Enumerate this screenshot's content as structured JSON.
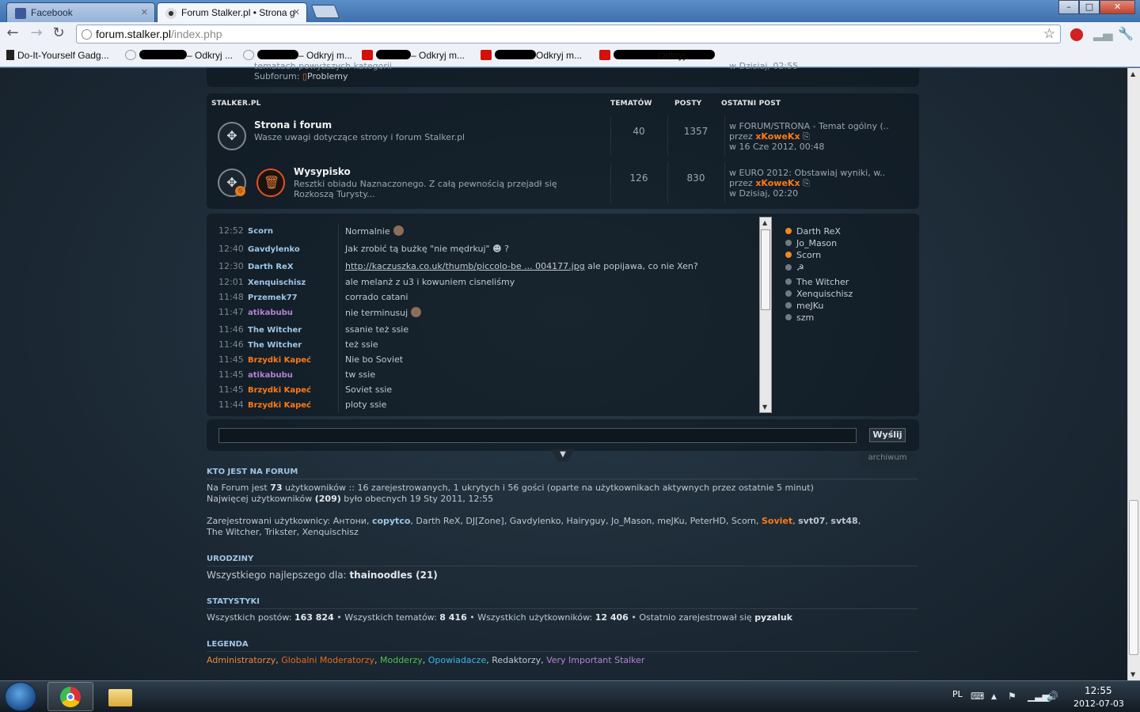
{
  "browser": {
    "tabs": [
      {
        "label": "Facebook",
        "icon": "facebook-icon"
      },
      {
        "label": "Forum Stalker.pl • Strona g",
        "icon": "stalker-icon"
      }
    ],
    "window_controls": {
      "minimize": "–",
      "maximize": "□",
      "close": "✕"
    },
    "address": {
      "host": "forum.stalker.pl",
      "path": "/index.php"
    },
    "bookmarks": [
      {
        "label": "Do-It-Yourself Gadg...",
        "icon": "bookmark-icon"
      },
      {
        "label": "– Odkryj ...",
        "icon": "globe-icon"
      },
      {
        "label": "– Odkryj m...",
        "icon": "globe-icon"
      },
      {
        "label": "– Odkryj m...",
        "icon": "lastfm-icon"
      },
      {
        "label": "Odkryj m...",
        "icon": "lastfm-icon"
      },
      {
        "label": "Odkryj",
        "icon": "lastfm-icon"
      }
    ]
  },
  "top_fragment": {
    "partial_text": "tematach powyższych kategorii",
    "subforum_label": "Subforum:",
    "subforum_link": "Problemy",
    "right_partial": "w Dzisiaj, 02:55"
  },
  "category": {
    "name": "STALKER.PL",
    "col_topics": "TEMATÓW",
    "col_posts": "POSTY",
    "col_last": "OSTATNI POST",
    "forums": [
      {
        "title": "Strona i forum",
        "desc1": "Wasze uwagi dotyczące strony i forum Stalker.pl",
        "desc2": "",
        "topics": "40",
        "posts": "1357",
        "last_in": "w FORUM/STRONA - Temat ogólny (..",
        "last_by_prefix": "przez",
        "last_user": "xKoweKx",
        "last_date": "w 16 Cze 2012, 00:48"
      },
      {
        "title": "Wysypisko",
        "desc1": "Resztki obiadu Naznaczonego. Z całą pewnością przejadł się",
        "desc2": "Rozkoszą Turysty...",
        "topics": "126",
        "posts": "830",
        "last_in": "w EURO 2012: Obstawiaj wyniki, w..",
        "last_by_prefix": "przez",
        "last_user": "xKoweKx",
        "last_date": "w Dzisiaj, 02:20"
      }
    ]
  },
  "chat": {
    "messages": [
      {
        "time": "12:52",
        "user": "Scorn",
        "color": "u-blue",
        "text": "Normalnie",
        "emoji": true
      },
      {
        "time": "12:40",
        "user": "Gavdylenko",
        "color": "u-blue",
        "text": "Jak zrobić tą bużkę \"nie mędrkuj\"",
        "suffix": "?",
        "emoji2": true
      },
      {
        "time": "12:30",
        "user": "Darth ReX",
        "color": "u-blue",
        "link": "http://kaczuszka.co.uk/thumb/piccolo-be ... 004177.jpg",
        "text": " ale popijawa, co nie Xen?"
      },
      {
        "time": "12:01",
        "user": "Xenquischisz",
        "color": "u-blue",
        "text": "ale melanż z u3 i kowuniem cisneliśmy"
      },
      {
        "time": "11:48",
        "user": "Przemek77",
        "color": "u-blue",
        "text": "corrado catani"
      },
      {
        "time": "11:47",
        "user": "atikabubu",
        "color": "u-purple",
        "text": "nie terminusuj",
        "emoji": true
      },
      {
        "time": "11:46",
        "user": "The Witcher",
        "color": "u-blue",
        "text": "ssanie też ssie"
      },
      {
        "time": "11:46",
        "user": "The Witcher",
        "color": "u-blue",
        "text": "też ssie"
      },
      {
        "time": "11:45",
        "user": "Brzydki Kapeć",
        "color": "u-orange",
        "text": "Nie bo Soviet"
      },
      {
        "time": "11:45",
        "user": "atikabubu",
        "color": "u-purple",
        "text": "tw ssie"
      },
      {
        "time": "11:45",
        "user": "Brzydki Kapeć",
        "color": "u-orange",
        "text": "Soviet ssie"
      },
      {
        "time": "11:44",
        "user": "Brzydki Kapeć",
        "color": "u-orange",
        "text": "ploty ssie"
      }
    ],
    "online": [
      {
        "name": "Darth ReX",
        "dot": "orange"
      },
      {
        "name": "Jo_Mason",
        "dot": "gray"
      },
      {
        "name": "Scorn",
        "dot": "orange"
      },
      {
        "name": "☭",
        "dot": "gray"
      },
      {
        "name": "The Witcher",
        "dot": "gray"
      },
      {
        "name": "Xenquischisz",
        "dot": "gray"
      },
      {
        "name": "meJKu",
        "dot": "gray"
      },
      {
        "name": "szm",
        "dot": "gray"
      }
    ],
    "input_value": "",
    "send_label": "Wyślij",
    "archive_label": "archiwum"
  },
  "who_online": {
    "heading": "KTO JEST NA FORUM",
    "line1_pre": "Na Forum jest",
    "line1_total": "73",
    "line1_post": "użytkowników :: 16 zarejestrowanych, 1 ukrytych i 56 gości (oparte na użytkownikach aktywnych przez ostatnie 5 minut)",
    "line2_pre": "Najwięcej użytkowników",
    "line2_max": "(209)",
    "line2_post": "było obecnych 19 Sty 2011, 12:55",
    "registered_label": "Zarejestrowani użytkownicy:",
    "registered_line1": [
      {
        "name": "Антони",
        "cls": "reg-user",
        "sep": ", "
      },
      {
        "name": "copytco",
        "cls": "u-blue b",
        "sep": ", "
      },
      {
        "name": "Darth ReX",
        "cls": "reg-user",
        "sep": ", "
      },
      {
        "name": "DJ[Zone]",
        "cls": "reg-user",
        "sep": ", "
      },
      {
        "name": "Gavdylenko",
        "cls": "reg-user",
        "sep": ", "
      },
      {
        "name": "Hairyguy",
        "cls": "reg-user",
        "sep": ", "
      },
      {
        "name": "Jo_Mason",
        "cls": "reg-user",
        "sep": ", "
      },
      {
        "name": "meJKu",
        "cls": "reg-user",
        "sep": ", "
      },
      {
        "name": "PeterHD",
        "cls": "reg-user",
        "sep": ", "
      },
      {
        "name": "Scorn",
        "cls": "reg-user",
        "sep": ", "
      },
      {
        "name": "Soviet",
        "cls": "u-orange b",
        "sep": ", "
      },
      {
        "name": "svt07",
        "cls": "u-gray b",
        "sep": ", "
      },
      {
        "name": "svt48",
        "cls": "u-gray b",
        "sep": ","
      }
    ],
    "registered_line2": "The Witcher, Trikster, Xenquischisz"
  },
  "birthdays": {
    "heading": "URODZINY",
    "text": "Wszystkiego najlepszego dla:",
    "user": "thainoodles (21)"
  },
  "stats": {
    "heading": "STATYSTYKI",
    "posts_label": "Wszystkich postów:",
    "posts": "163 824",
    "topics_label": "• Wszystkich tematów:",
    "topics": "8 416",
    "users_label": "• Wszystkich użytkowników:",
    "users": "12 406",
    "newest_label": "• Ostatnio zarejestrował się",
    "newest": "pyzaluk"
  },
  "legend": {
    "heading": "LEGENDA",
    "groups": [
      {
        "name": "Administratorzy",
        "color": "#f0883a",
        "sep": ", "
      },
      {
        "name": "Globalni Moderatorzy",
        "color": "#e26b1f",
        "sep": ", "
      },
      {
        "name": "Modderzy",
        "color": "#4fc24a",
        "sep": ", "
      },
      {
        "name": "Opowiadacze",
        "color": "#35b6e8",
        "sep": ", "
      },
      {
        "name": "Redaktorzy",
        "color": "#c0c8cf",
        "sep": ", "
      },
      {
        "name": "Very Important Stalker",
        "color": "#b681d6",
        "sep": ""
      }
    ]
  },
  "taskbar": {
    "lang": "PL",
    "time": "12:55",
    "date": "2012-07-03"
  }
}
